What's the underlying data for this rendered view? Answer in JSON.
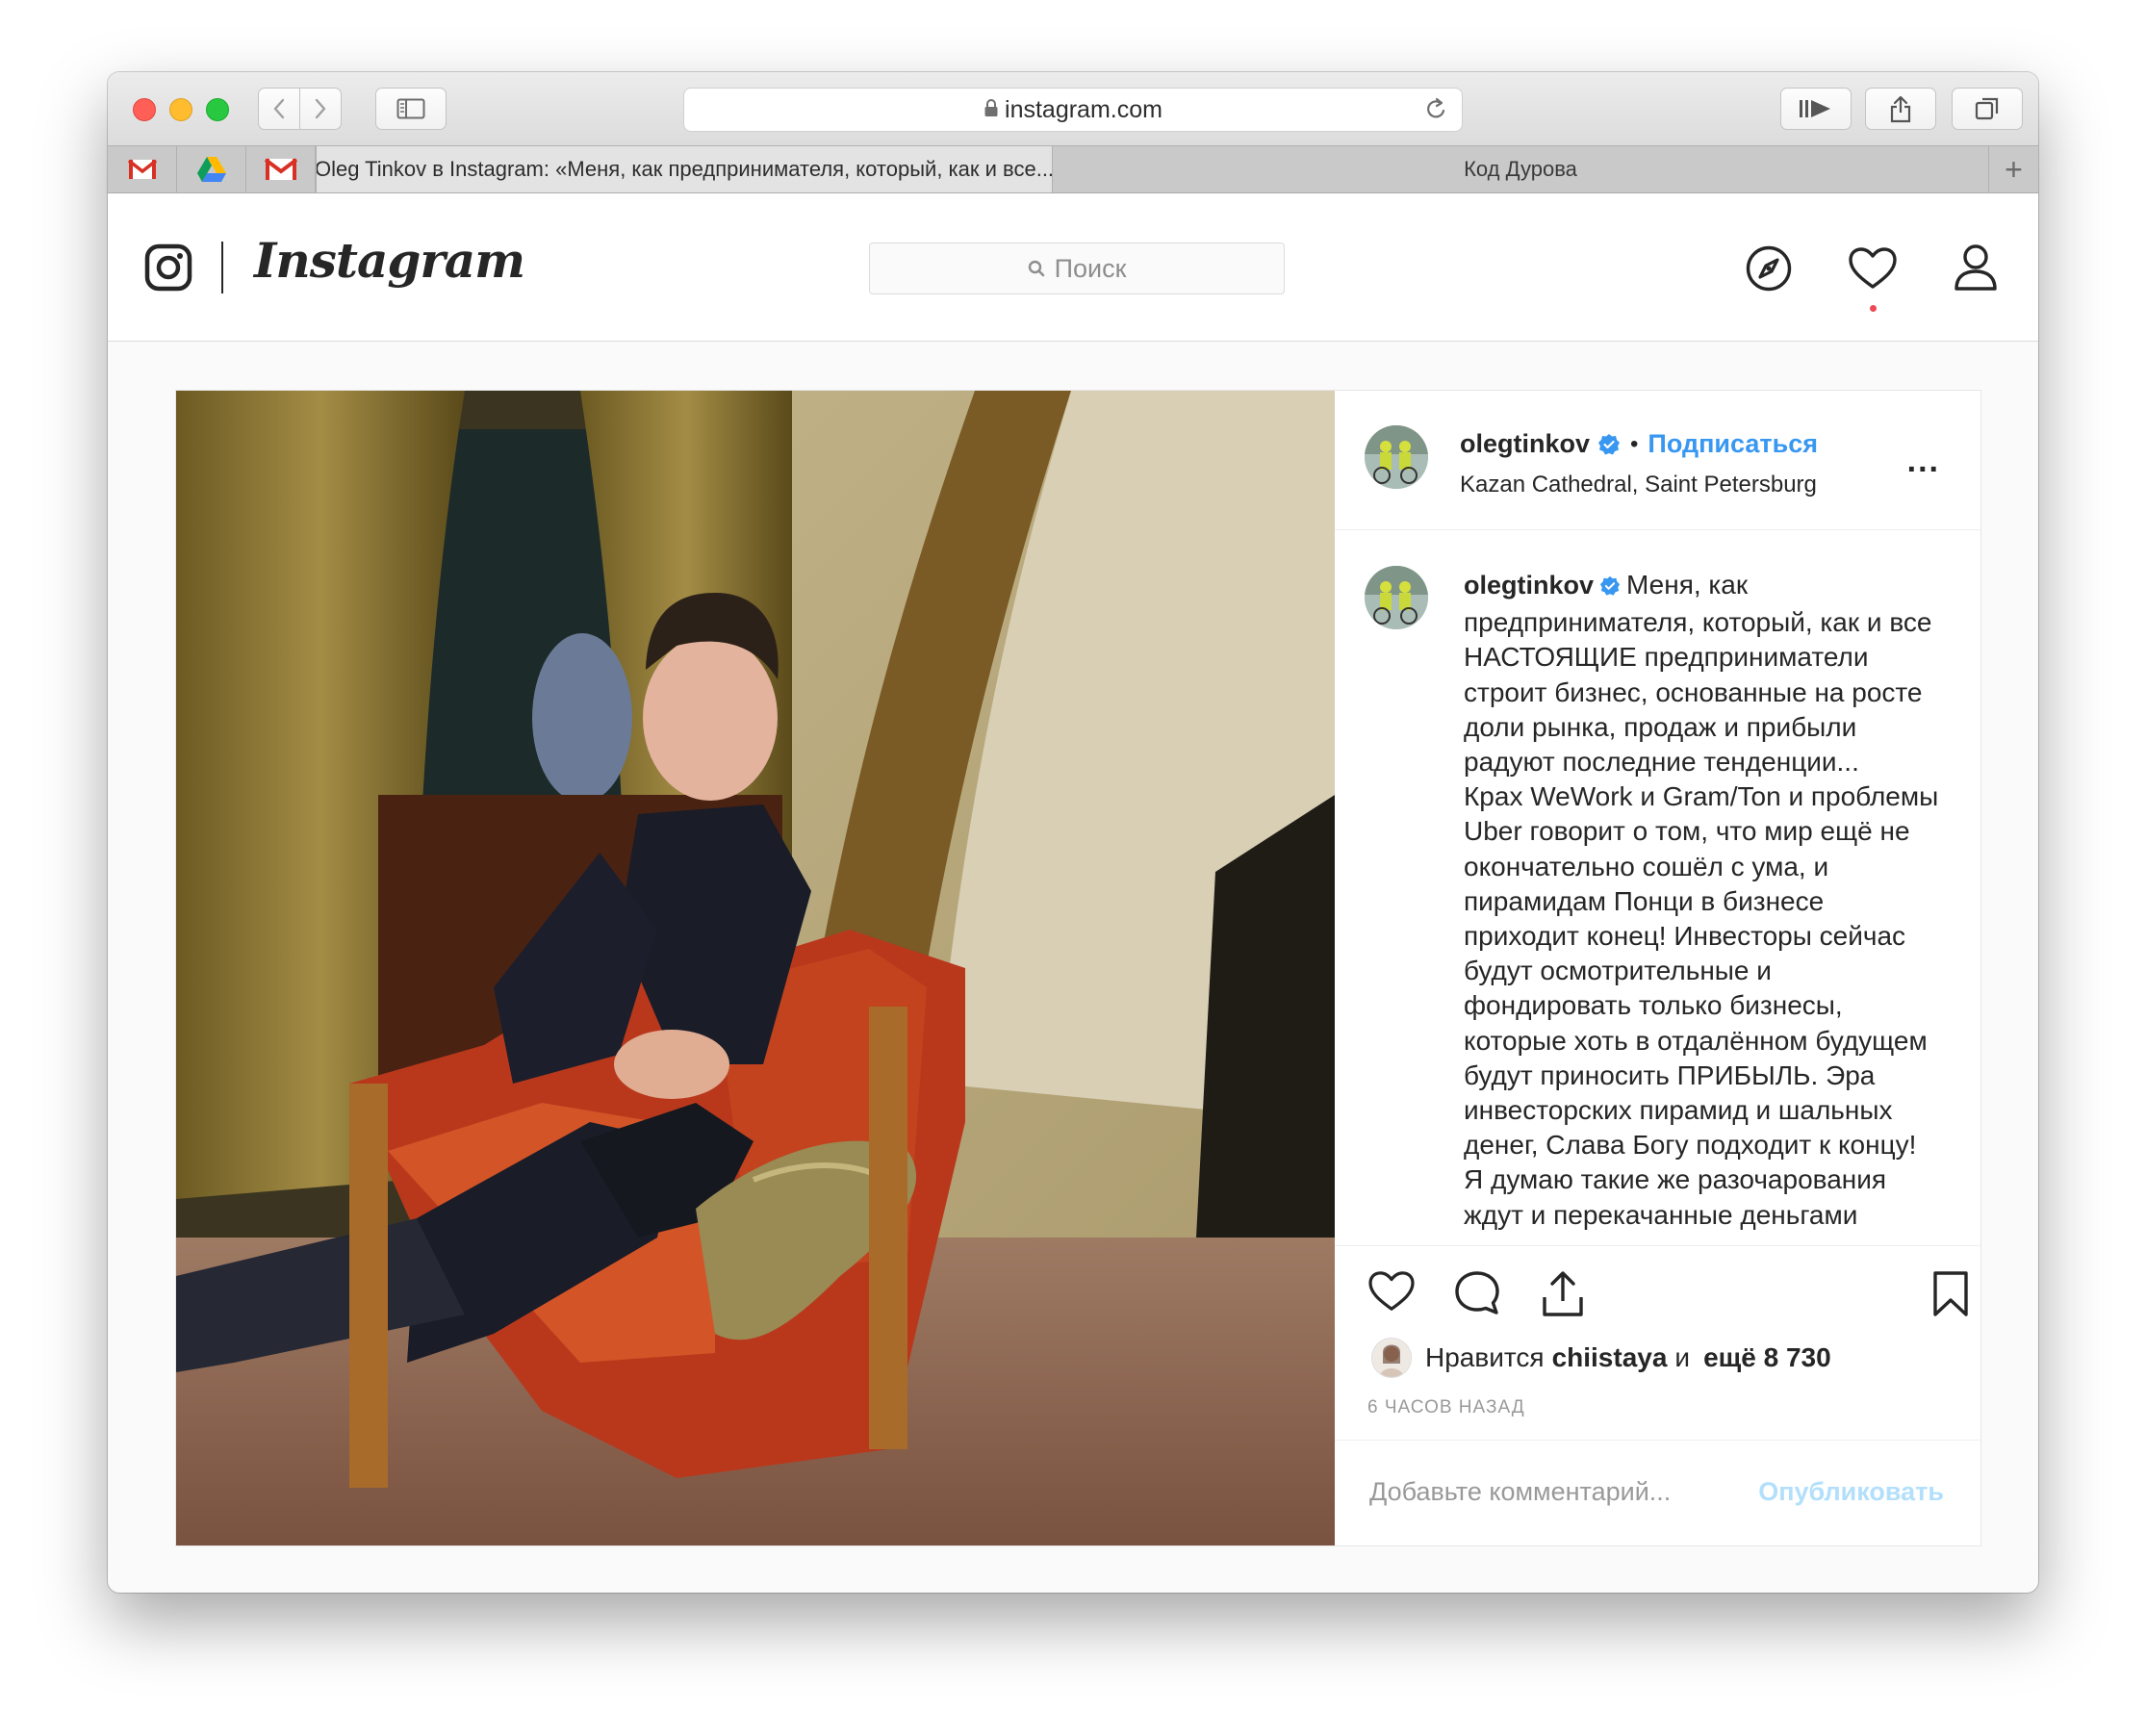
{
  "browser": {
    "url": "instagram.com",
    "colors": {
      "close": "#ff5f57",
      "minimize": "#febc2e",
      "zoom": "#28c840"
    },
    "pinned_tabs": [
      {
        "name": "gmail-icon"
      },
      {
        "name": "google-drive-icon"
      },
      {
        "name": "gmail-icon"
      }
    ],
    "tabs": [
      {
        "label": "Oleg Tinkov в Instagram: «Меня, как предпринимателя, который, как и все...",
        "active": true
      },
      {
        "label": "Код Дурова",
        "active": false
      }
    ],
    "new_tab_label": "+"
  },
  "instagram": {
    "wordmark": "Instagram",
    "search_placeholder": "Поиск",
    "accent_color": "#3897f0",
    "notification_dot_color": "#ed4956"
  },
  "post": {
    "username": "olegtinkov",
    "separator": "•",
    "follow_label": "Подписаться",
    "location": "Kazan Cathedral, Saint Petersburg",
    "more_label": "...",
    "caption_lines": [
      "Меня, как",
      "предпринимателя, который, как и все",
      "НАСТОЯЩИЕ предприниматели",
      "строит бизнес, основанные на росте",
      "доли рынка, продаж и прибыли",
      "радуют последние тенденции...",
      "Крах WeWork и Gram/Ton и проблемы",
      "Uber говорит о том, что мир ещё не",
      "окончательно сошёл с ума, и",
      "пирамидам Понци в бизнесе",
      "приходит конец! Инвесторы сейчас",
      "будут осмотрительные и",
      "фондировать только бизнесы,",
      "которые хоть в отдалённом будущем",
      "будут приносить ПРИБЫЛЬ. Эра",
      "инвесторских пирамид и шальных",
      "денег, Слава Богу подходит к концу!",
      "Я думаю такие же разочарования",
      "ждут и перекачанные деньгами"
    ],
    "likes_prefix": "Нравится",
    "likes_user": "chiistaya",
    "likes_and": "и",
    "likes_more": "ещё 8 730",
    "time_ago": "6 ЧАСОВ НАЗАД",
    "comment_placeholder": "Добавьте комментарий...",
    "publish_label": "Опубликовать"
  }
}
